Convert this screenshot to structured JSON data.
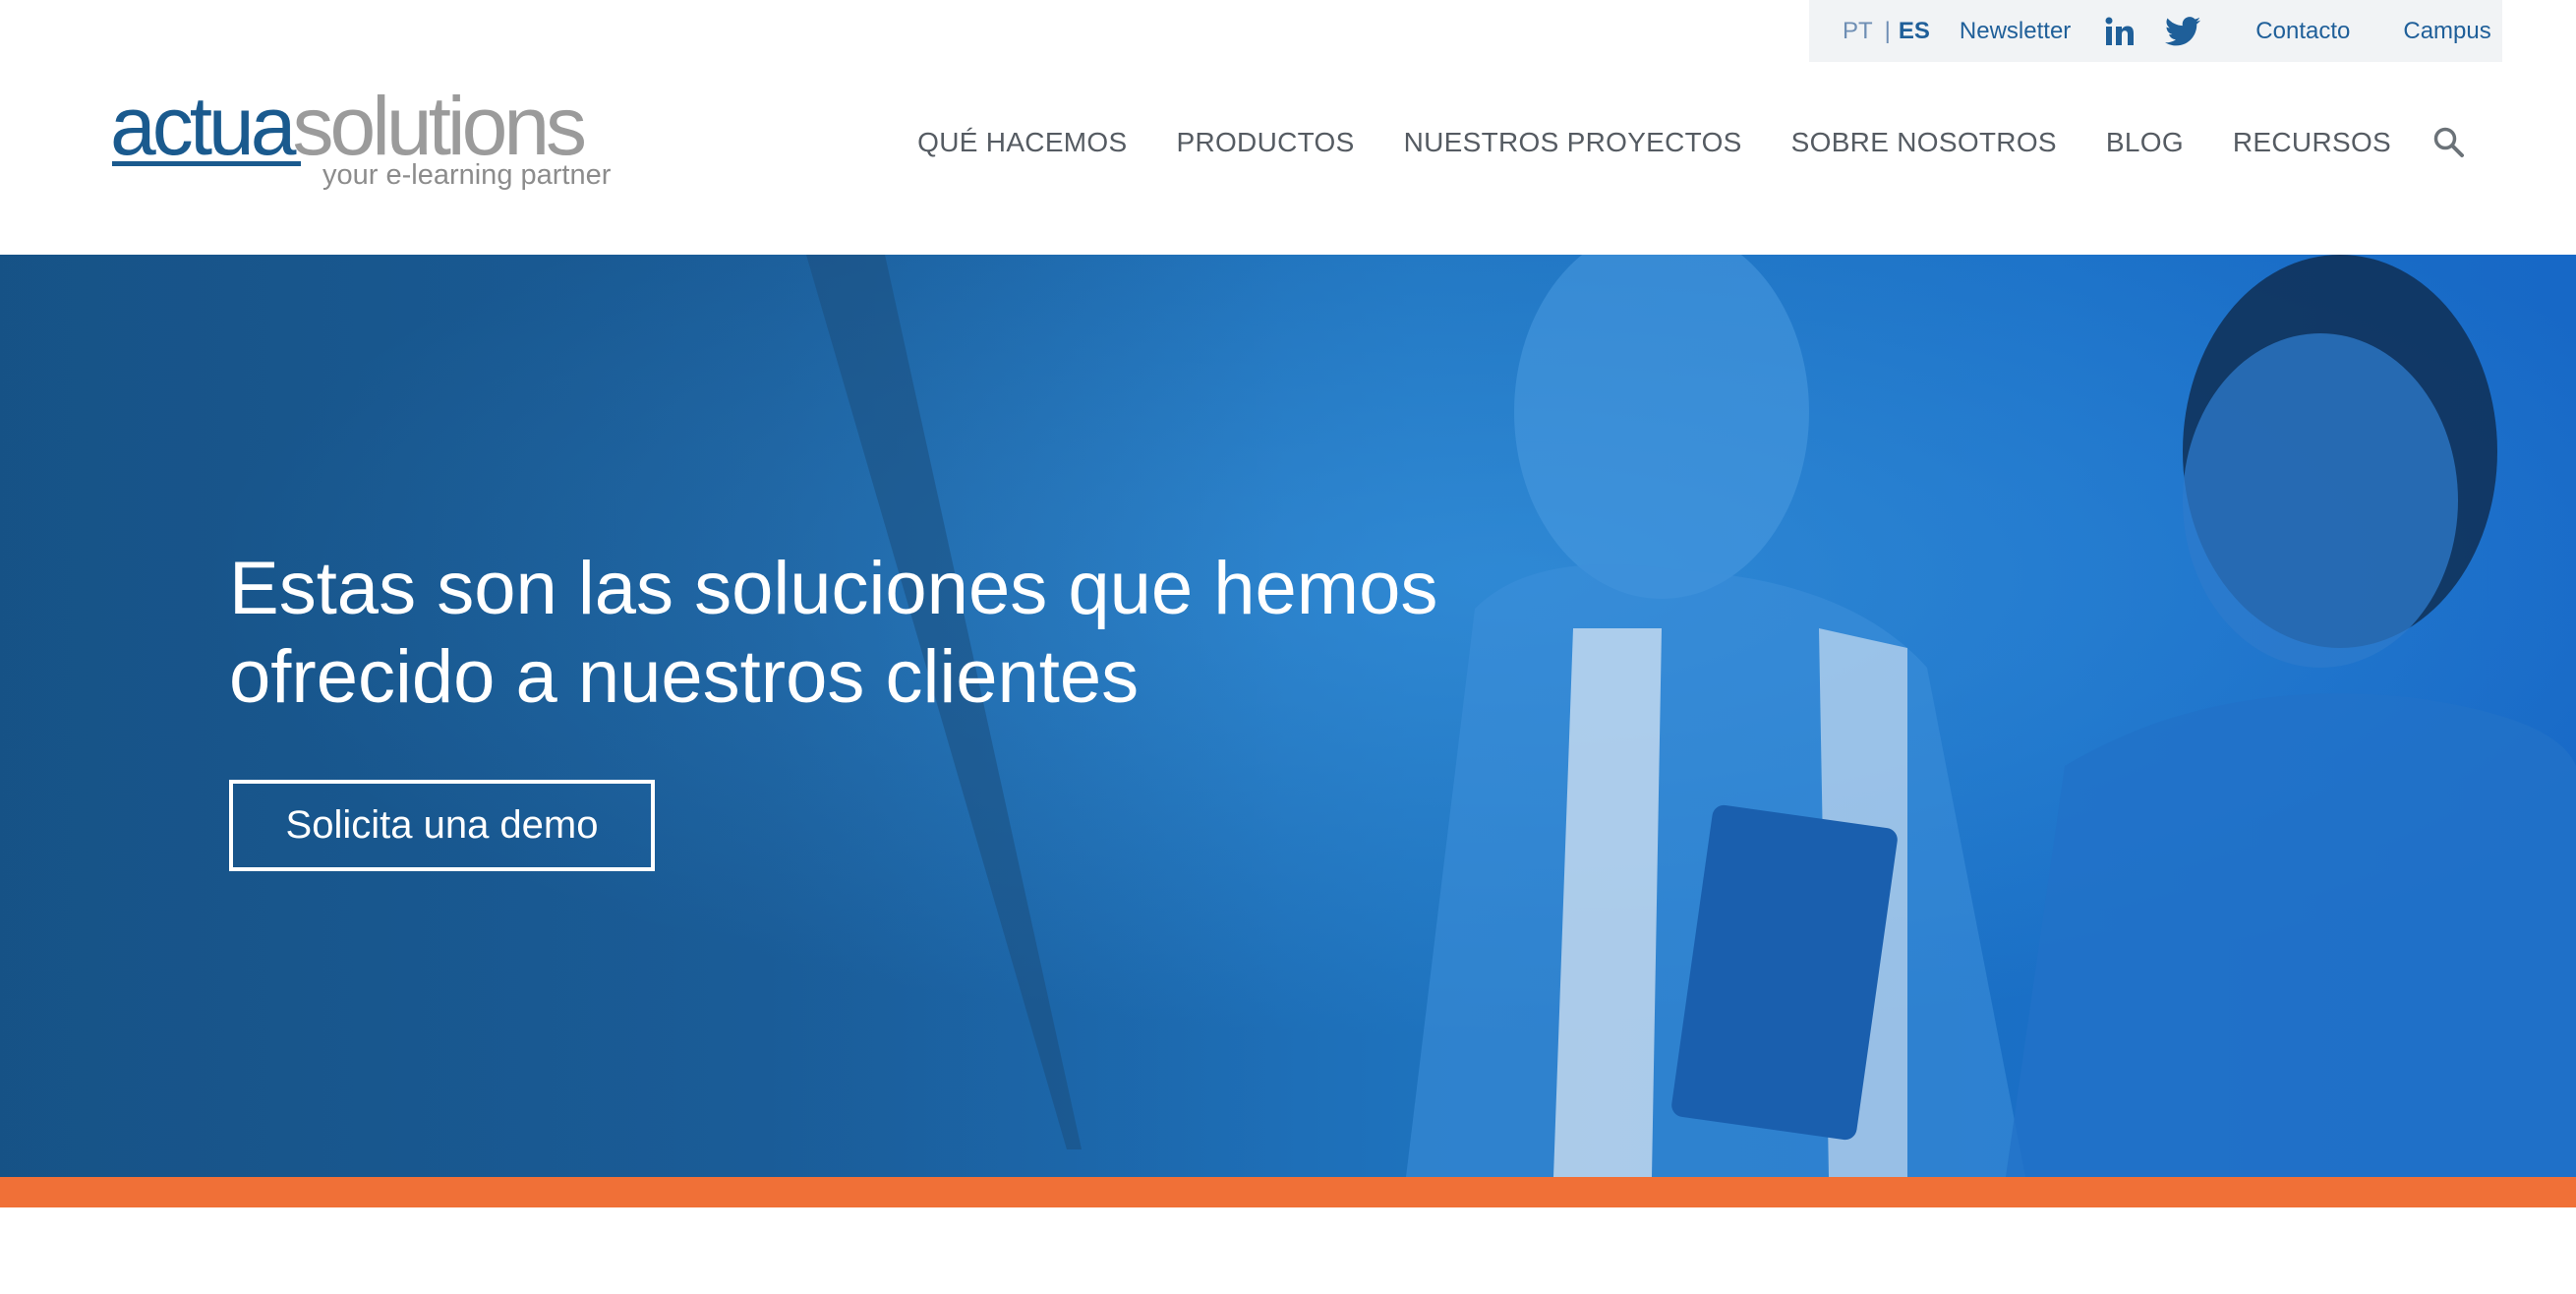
{
  "utility": {
    "lang_pt": "PT",
    "lang_sep": "|",
    "lang_es": "ES",
    "newsletter": "Newsletter",
    "linkedin_icon": "linkedin-icon",
    "twitter_icon": "twitter-icon",
    "contacto": "Contacto",
    "campus": "Campus"
  },
  "logo": {
    "part_a": "actua",
    "part_b": "solutions",
    "tagline": "your e-learning partner"
  },
  "nav": {
    "items": [
      "QUÉ HACEMOS",
      "PRODUCTOS",
      "NUESTROS PROYECTOS",
      "SOBRE NOSOTROS",
      "BLOG",
      "RECURSOS"
    ],
    "search_icon": "search-icon"
  },
  "hero": {
    "title_line1": "Estas son las soluciones que hemos",
    "title_line2": "ofrecido a nuestros clientes",
    "button": "Solicita una demo"
  },
  "colors": {
    "brand_blue": "#1a5a8e",
    "accent_orange": "#f07037",
    "hero_blue": "#1e72bd"
  }
}
